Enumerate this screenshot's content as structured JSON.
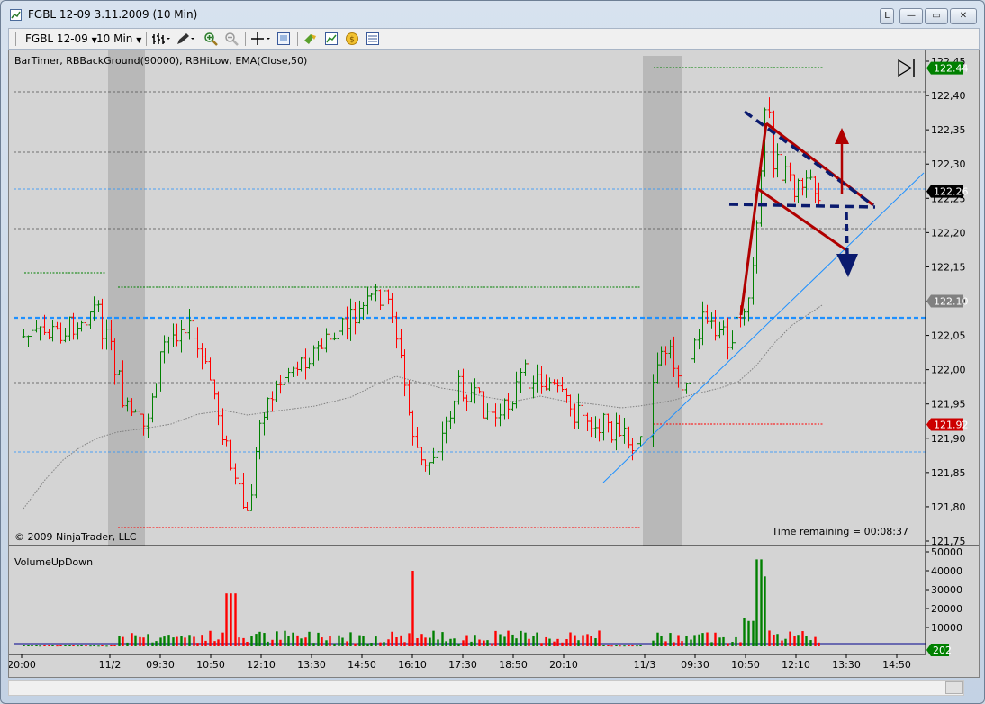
{
  "window": {
    "title": "FGBL 12-09  3.11.2009 (10 Min)",
    "buttons": [
      "L",
      "—",
      "▭",
      "✕"
    ]
  },
  "toolbar": {
    "instrument": "FGBL 12-09",
    "interval": "10 Min",
    "icons": [
      "bar-type-icon",
      "pencil-icon",
      "zoom-in-icon",
      "zoom-out-icon",
      "crosshair-icon",
      "properties-icon",
      "strategy-icon",
      "indicator-icon",
      "coin-icon",
      "data-box-icon"
    ]
  },
  "price_panel": {
    "indicators_label": "BarTimer, RBBackGround(90000), RBHiLow, EMA(Close,50)",
    "copyright": "© 2009 NinjaTrader, LLC",
    "time_remaining": "Time remaining = 00:08:37",
    "axis_ticks": [
      "122,45",
      "122,40",
      "122,35",
      "122,30",
      "122,25",
      "122,20",
      "122,15",
      "122,10",
      "122,05",
      "122,00",
      "121,95",
      "121,90",
      "121,85",
      "121,80",
      "121,75"
    ],
    "axis_tick_values": [
      122.45,
      122.4,
      122.35,
      122.3,
      122.25,
      122.2,
      122.15,
      122.1,
      122.05,
      122.0,
      121.95,
      121.9,
      121.85,
      121.8,
      121.75
    ],
    "price_labels": [
      {
        "text": "122.44",
        "value": 122.44,
        "color": "#008000"
      },
      {
        "text": "122.26",
        "value": 122.26,
        "color": "#000000"
      },
      {
        "text": "122.10",
        "value": 122.1,
        "color": "#808080"
      },
      {
        "text": "121.92",
        "value": 121.92,
        "color": "#cc0000"
      }
    ]
  },
  "volume_panel": {
    "label": "VolumeUpDown",
    "axis_ticks": [
      "50000",
      "40000",
      "30000",
      "20000",
      "10000"
    ],
    "axis_tick_values": [
      50000,
      40000,
      30000,
      20000,
      10000
    ],
    "current": {
      "text": "202",
      "value": 202,
      "color": "#008000"
    }
  },
  "x_axis": {
    "labels": [
      "20:00",
      "11/2",
      "09:30",
      "10:50",
      "12:10",
      "13:30",
      "14:50",
      "16:10",
      "17:30",
      "18:50",
      "20:10",
      "11/3",
      "09:30",
      "10:50",
      "12:10",
      "13:30",
      "14:50"
    ]
  },
  "colors": {
    "up": "#008000",
    "down": "#ff0000",
    "background": "#d4d4d4",
    "session_shade": "#b8b8b8",
    "blue_line": "#1e90ff",
    "annotation_red": "#b00000",
    "annotation_navy": "#0a1a6e"
  },
  "chart_data": {
    "type": "candlestick",
    "price_range": [
      121.75,
      122.45
    ],
    "volume_range": [
      0,
      50000
    ]
  }
}
